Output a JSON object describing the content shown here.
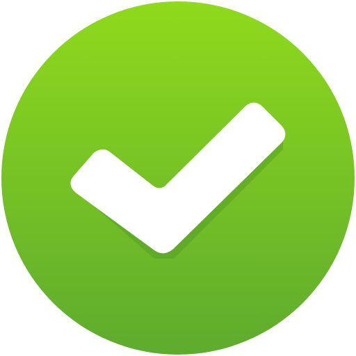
{
  "icon": {
    "name": "checkmark-circle-icon",
    "symbol": "check",
    "colors": {
      "circle_top": "#8fda1c",
      "circle_bottom": "#5eab2e",
      "check_fill": "#ffffff",
      "check_shadow": "#4f9a25"
    }
  }
}
